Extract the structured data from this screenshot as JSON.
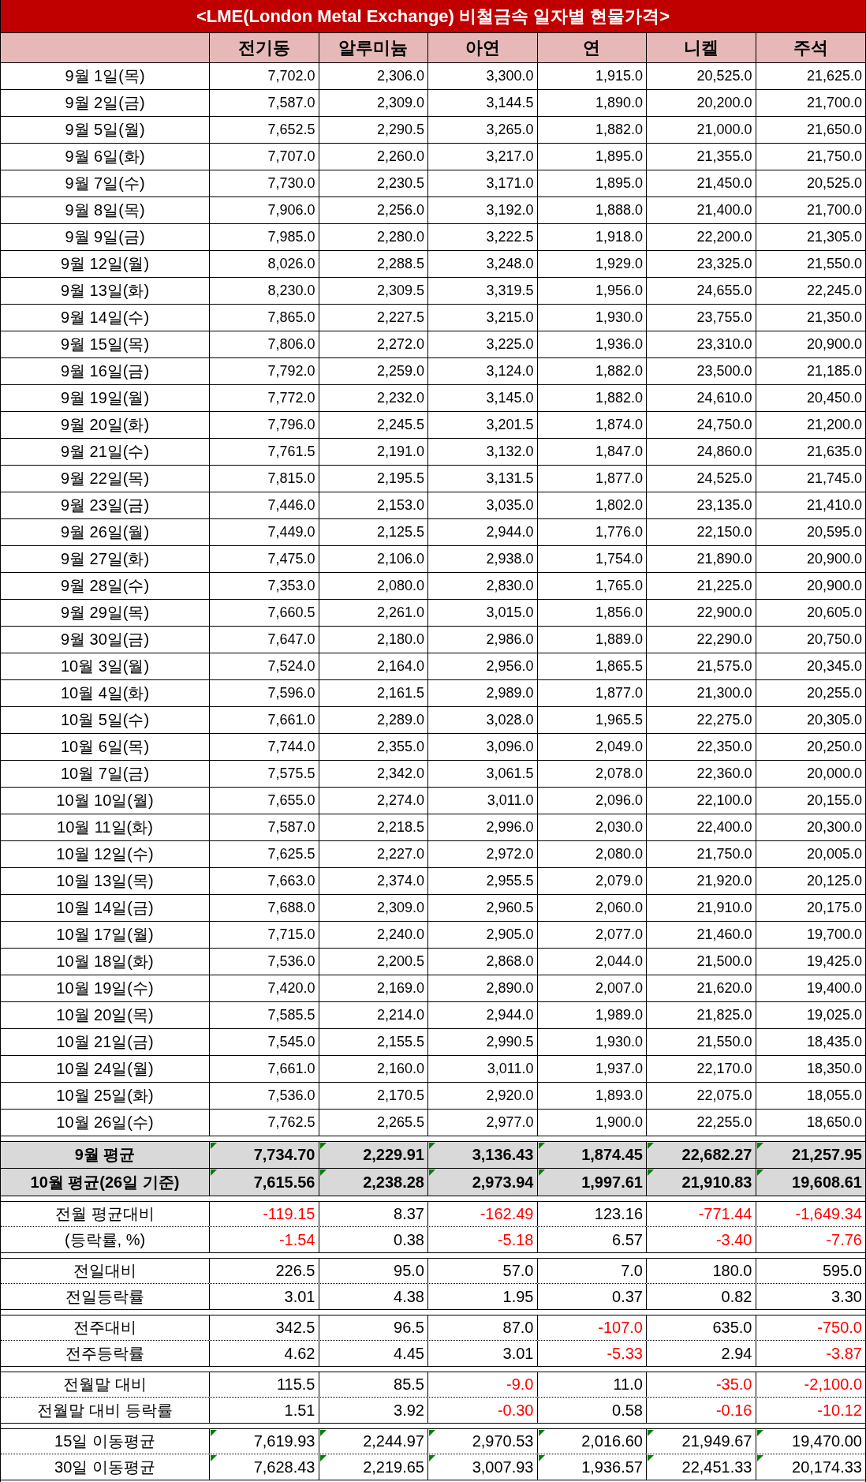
{
  "title": "<LME(London Metal Exchange) 비철금속 일자별 현물가격>",
  "columns": [
    "전기동",
    "알루미늄",
    "아연",
    "연",
    "니켈",
    "주석"
  ],
  "daily_rows": [
    {
      "date": "9월 1일(목)",
      "values": [
        "7,702.0",
        "2,306.0",
        "3,300.0",
        "1,915.0",
        "20,525.0",
        "21,625.0"
      ]
    },
    {
      "date": "9월 2일(금)",
      "values": [
        "7,587.0",
        "2,309.0",
        "3,144.5",
        "1,890.0",
        "20,200.0",
        "21,700.0"
      ]
    },
    {
      "date": "9월 5일(월)",
      "values": [
        "7,652.5",
        "2,290.5",
        "3,265.0",
        "1,882.0",
        "21,000.0",
        "21,650.0"
      ]
    },
    {
      "date": "9월 6일(화)",
      "values": [
        "7,707.0",
        "2,260.0",
        "3,217.0",
        "1,895.0",
        "21,355.0",
        "21,750.0"
      ]
    },
    {
      "date": "9월 7일(수)",
      "values": [
        "7,730.0",
        "2,230.5",
        "3,171.0",
        "1,895.0",
        "21,450.0",
        "20,525.0"
      ]
    },
    {
      "date": "9월 8일(목)",
      "values": [
        "7,906.0",
        "2,256.0",
        "3,192.0",
        "1,888.0",
        "21,400.0",
        "21,700.0"
      ]
    },
    {
      "date": "9월 9일(금)",
      "values": [
        "7,985.0",
        "2,280.0",
        "3,222.5",
        "1,918.0",
        "22,200.0",
        "21,305.0"
      ]
    },
    {
      "date": "9월 12일(월)",
      "values": [
        "8,026.0",
        "2,288.5",
        "3,248.0",
        "1,929.0",
        "23,325.0",
        "21,550.0"
      ]
    },
    {
      "date": "9월 13일(화)",
      "values": [
        "8,230.0",
        "2,309.5",
        "3,319.5",
        "1,956.0",
        "24,655.0",
        "22,245.0"
      ]
    },
    {
      "date": "9월 14일(수)",
      "values": [
        "7,865.0",
        "2,227.5",
        "3,215.0",
        "1,930.0",
        "23,755.0",
        "21,350.0"
      ]
    },
    {
      "date": "9월 15일(목)",
      "values": [
        "7,806.0",
        "2,272.0",
        "3,225.0",
        "1,936.0",
        "23,310.0",
        "20,900.0"
      ]
    },
    {
      "date": "9월 16일(금)",
      "values": [
        "7,792.0",
        "2,259.0",
        "3,124.0",
        "1,882.0",
        "23,500.0",
        "21,185.0"
      ]
    },
    {
      "date": "9월 19일(월)",
      "values": [
        "7,772.0",
        "2,232.0",
        "3,145.0",
        "1,882.0",
        "24,610.0",
        "20,450.0"
      ]
    },
    {
      "date": "9월 20일(화)",
      "values": [
        "7,796.0",
        "2,245.5",
        "3,201.5",
        "1,874.0",
        "24,750.0",
        "21,200.0"
      ]
    },
    {
      "date": "9월 21일(수)",
      "values": [
        "7,761.5",
        "2,191.0",
        "3,132.0",
        "1,847.0",
        "24,860.0",
        "21,635.0"
      ]
    },
    {
      "date": "9월 22일(목)",
      "values": [
        "7,815.0",
        "2,195.5",
        "3,131.5",
        "1,877.0",
        "24,525.0",
        "21,745.0"
      ]
    },
    {
      "date": "9월 23일(금)",
      "values": [
        "7,446.0",
        "2,153.0",
        "3,035.0",
        "1,802.0",
        "23,135.0",
        "21,410.0"
      ]
    },
    {
      "date": "9월 26일(월)",
      "values": [
        "7,449.0",
        "2,125.5",
        "2,944.0",
        "1,776.0",
        "22,150.0",
        "20,595.0"
      ]
    },
    {
      "date": "9월 27일(화)",
      "values": [
        "7,475.0",
        "2,106.0",
        "2,938.0",
        "1,754.0",
        "21,890.0",
        "20,900.0"
      ]
    },
    {
      "date": "9월 28일(수)",
      "values": [
        "7,353.0",
        "2,080.0",
        "2,830.0",
        "1,765.0",
        "21,225.0",
        "20,900.0"
      ]
    },
    {
      "date": "9월 29일(목)",
      "values": [
        "7,660.5",
        "2,261.0",
        "3,015.0",
        "1,856.0",
        "22,900.0",
        "20,605.0"
      ]
    },
    {
      "date": "9월 30일(금)",
      "values": [
        "7,647.0",
        "2,180.0",
        "2,986.0",
        "1,889.0",
        "22,290.0",
        "20,750.0"
      ]
    },
    {
      "date": "10월 3일(월)",
      "values": [
        "7,524.0",
        "2,164.0",
        "2,956.0",
        "1,865.5",
        "21,575.0",
        "20,345.0"
      ]
    },
    {
      "date": "10월 4일(화)",
      "values": [
        "7,596.0",
        "2,161.5",
        "2,989.0",
        "1,877.0",
        "21,300.0",
        "20,255.0"
      ]
    },
    {
      "date": "10월 5일(수)",
      "values": [
        "7,661.0",
        "2,289.0",
        "3,028.0",
        "1,965.5",
        "22,275.0",
        "20,305.0"
      ]
    },
    {
      "date": "10월 6일(목)",
      "values": [
        "7,744.0",
        "2,355.0",
        "3,096.0",
        "2,049.0",
        "22,350.0",
        "20,250.0"
      ]
    },
    {
      "date": "10월 7일(금)",
      "values": [
        "7,575.5",
        "2,342.0",
        "3,061.5",
        "2,078.0",
        "22,360.0",
        "20,000.0"
      ]
    },
    {
      "date": "10월 10일(월)",
      "values": [
        "7,655.0",
        "2,274.0",
        "3,011.0",
        "2,096.0",
        "22,100.0",
        "20,155.0"
      ]
    },
    {
      "date": "10월 11일(화)",
      "values": [
        "7,587.0",
        "2,218.5",
        "2,996.0",
        "2,030.0",
        "22,400.0",
        "20,300.0"
      ]
    },
    {
      "date": "10월 12일(수)",
      "values": [
        "7,625.5",
        "2,227.0",
        "2,972.0",
        "2,080.0",
        "21,750.0",
        "20,005.0"
      ]
    },
    {
      "date": "10월 13일(목)",
      "values": [
        "7,663.0",
        "2,374.0",
        "2,955.5",
        "2,079.0",
        "21,920.0",
        "20,125.0"
      ]
    },
    {
      "date": "10월 14일(금)",
      "values": [
        "7,688.0",
        "2,309.0",
        "2,960.5",
        "2,060.0",
        "21,910.0",
        "20,175.0"
      ]
    },
    {
      "date": "10월 17일(월)",
      "values": [
        "7,715.0",
        "2,240.0",
        "2,905.0",
        "2,077.0",
        "21,460.0",
        "19,700.0"
      ]
    },
    {
      "date": "10월 18일(화)",
      "values": [
        "7,536.0",
        "2,200.5",
        "2,868.0",
        "2,044.0",
        "21,500.0",
        "19,425.0"
      ]
    },
    {
      "date": "10월 19일(수)",
      "values": [
        "7,420.0",
        "2,169.0",
        "2,890.0",
        "2,007.0",
        "21,620.0",
        "19,400.0"
      ]
    },
    {
      "date": "10월 20일(목)",
      "values": [
        "7,585.5",
        "2,214.0",
        "2,944.0",
        "1,989.0",
        "21,825.0",
        "19,025.0"
      ]
    },
    {
      "date": "10월 21일(금)",
      "values": [
        "7,545.0",
        "2,155.5",
        "2,990.5",
        "1,930.0",
        "21,550.0",
        "18,435.0"
      ]
    },
    {
      "date": "10월 24일(월)",
      "values": [
        "7,661.0",
        "2,160.0",
        "3,011.0",
        "1,937.0",
        "22,170.0",
        "18,350.0"
      ]
    },
    {
      "date": "10월 25일(화)",
      "values": [
        "7,536.0",
        "2,170.5",
        "2,920.0",
        "1,893.0",
        "22,075.0",
        "18,055.0"
      ]
    },
    {
      "date": "10월 26일(수)",
      "values": [
        "7,762.5",
        "2,265.5",
        "2,977.0",
        "1,900.0",
        "22,255.0",
        "18,650.0"
      ]
    }
  ],
  "sections": [
    {
      "kind": "average",
      "rows": [
        {
          "label": "9월 평균",
          "flagged": true,
          "values": [
            "7,734.70",
            "2,229.91",
            "3,136.43",
            "1,874.45",
            "22,682.27",
            "21,257.95"
          ],
          "negative": [
            false,
            false,
            false,
            false,
            false,
            false
          ]
        },
        {
          "label": "10월 평균(26일 기준)",
          "flagged": true,
          "values": [
            "7,615.56",
            "2,238.28",
            "2,973.94",
            "1,997.61",
            "21,910.83",
            "19,608.61"
          ],
          "negative": [
            false,
            false,
            false,
            false,
            false,
            false
          ]
        }
      ]
    },
    {
      "kind": "change",
      "rows": [
        {
          "label": "전월 평균대비",
          "flagged": false,
          "values": [
            "-119.15",
            "8.37",
            "-162.49",
            "123.16",
            "-771.44",
            "-1,649.34"
          ],
          "negative": [
            true,
            false,
            true,
            false,
            true,
            true
          ]
        },
        {
          "label": "(등락률, %)",
          "flagged": false,
          "values": [
            "-1.54",
            "0.38",
            "-5.18",
            "6.57",
            "-3.40",
            "-7.76"
          ],
          "negative": [
            true,
            false,
            true,
            false,
            true,
            true
          ]
        }
      ]
    },
    {
      "kind": "change",
      "rows": [
        {
          "label": "전일대비",
          "flagged": false,
          "values": [
            "226.5",
            "95.0",
            "57.0",
            "7.0",
            "180.0",
            "595.0"
          ],
          "negative": [
            false,
            false,
            false,
            false,
            false,
            false
          ]
        },
        {
          "label": "전일등락률",
          "flagged": false,
          "values": [
            "3.01",
            "4.38",
            "1.95",
            "0.37",
            "0.82",
            "3.30"
          ],
          "negative": [
            false,
            false,
            false,
            false,
            false,
            false
          ]
        }
      ]
    },
    {
      "kind": "change",
      "rows": [
        {
          "label": "전주대비",
          "flagged": false,
          "values": [
            "342.5",
            "96.5",
            "87.0",
            "-107.0",
            "635.0",
            "-750.0"
          ],
          "negative": [
            false,
            false,
            false,
            true,
            false,
            true
          ]
        },
        {
          "label": "전주등락률",
          "flagged": false,
          "values": [
            "4.62",
            "4.45",
            "3.01",
            "-5.33",
            "2.94",
            "-3.87"
          ],
          "negative": [
            false,
            false,
            false,
            true,
            false,
            true
          ]
        }
      ]
    },
    {
      "kind": "change",
      "rows": [
        {
          "label": "전월말 대비",
          "flagged": false,
          "values": [
            "115.5",
            "85.5",
            "-9.0",
            "11.0",
            "-35.0",
            "-2,100.0"
          ],
          "negative": [
            false,
            false,
            true,
            false,
            true,
            true
          ]
        },
        {
          "label": "전월말 대비 등락률",
          "flagged": false,
          "values": [
            "1.51",
            "3.92",
            "-0.30",
            "0.58",
            "-0.16",
            "-10.12"
          ],
          "negative": [
            false,
            false,
            true,
            false,
            true,
            true
          ]
        }
      ]
    },
    {
      "kind": "change",
      "rows": [
        {
          "label": "15일 이동평균",
          "flagged": true,
          "values": [
            "7,619.93",
            "2,244.97",
            "2,970.53",
            "2,016.60",
            "21,949.67",
            "19,470.00"
          ],
          "negative": [
            false,
            false,
            false,
            false,
            false,
            false
          ]
        },
        {
          "label": "30일 이동평균",
          "flagged": true,
          "values": [
            "7,628.43",
            "2,219.65",
            "3,007.93",
            "1,936.57",
            "22,451.33",
            "20,174.33"
          ],
          "negative": [
            false,
            false,
            false,
            false,
            false,
            false
          ]
        }
      ]
    }
  ]
}
